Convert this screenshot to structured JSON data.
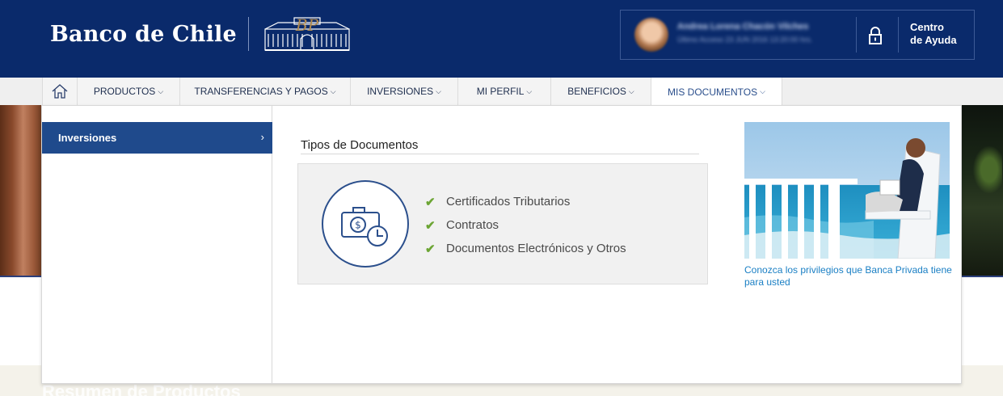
{
  "header": {
    "brand_name": "Banco de Chile",
    "brand_emblem": "building-emblem-logo",
    "user": {
      "name": "Andrea Lorena Chacón Vilches",
      "last_access": "Último Acceso 23 JUN 2016 13:20:00 hrs."
    },
    "lock_icon": "lock-icon",
    "help_label_line1": "Centro",
    "help_label_line2": "de Ayuda"
  },
  "nav": {
    "home_icon": "home-icon",
    "items": [
      {
        "label": "PRODUCTOS"
      },
      {
        "label": "TRANSFERENCIAS Y PAGOS"
      },
      {
        "label": "INVERSIONES"
      },
      {
        "label": "MI PERFIL"
      },
      {
        "label": "BENEFICIOS"
      },
      {
        "label": "MIS DOCUMENTOS"
      }
    ],
    "active_index": 5
  },
  "dropdown": {
    "sidebar": {
      "items": [
        {
          "label": "Inversiones",
          "selected": true
        }
      ]
    },
    "section_title": "Tipos de Documentos",
    "document_types": [
      {
        "label": "Certificados Tributarios"
      },
      {
        "label": "Contratos"
      },
      {
        "label": "Documentos Electrónicos y Otros"
      }
    ],
    "promo": {
      "image": "man-relaxing-on-deck-chair-by-sea",
      "link_text": "Conozca los privilegios que Banca Privada tiene para usted"
    }
  },
  "background": {
    "section_heading": "Resumen de Productos"
  },
  "colors": {
    "header_bg": "#0a2a6b",
    "accent_blue": "#1f4a8c",
    "link_blue": "#1a7fc4",
    "check_green": "#6ca534",
    "nav_bg": "#efefef"
  }
}
